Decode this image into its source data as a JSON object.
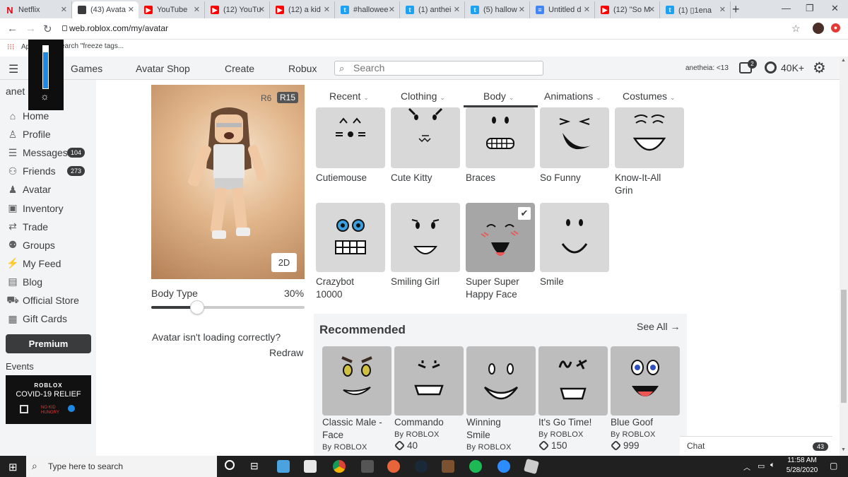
{
  "browser": {
    "tabs": [
      {
        "title": "Netflix",
        "icon": "netflix-icon",
        "color": "#e50914",
        "glyph": "N"
      },
      {
        "title": "(43) Avata",
        "icon": "roblox-icon",
        "color": "#393b3d",
        "glyph": ""
      },
      {
        "title": "YouTube",
        "icon": "youtube-icon",
        "color": "#ff0000",
        "glyph": "▶"
      },
      {
        "title": "(12) YouTu",
        "icon": "youtube-icon",
        "color": "#ff0000",
        "glyph": "▶"
      },
      {
        "title": "(12) a kid",
        "icon": "youtube-icon",
        "color": "#ff0000",
        "glyph": "▶"
      },
      {
        "title": "#hallowee",
        "icon": "twitter-icon",
        "color": "#1da1f2",
        "glyph": "t"
      },
      {
        "title": "(1) anthei",
        "icon": "twitter-icon",
        "color": "#1da1f2",
        "glyph": "t"
      },
      {
        "title": "(5) hallow",
        "icon": "twitter-icon",
        "color": "#1da1f2",
        "glyph": "t"
      },
      {
        "title": "Untitled d",
        "icon": "docs-icon",
        "color": "#4285f4",
        "glyph": "≡"
      },
      {
        "title": "(12) \"So M",
        "icon": "youtube-icon",
        "color": "#ff0000",
        "glyph": "▶"
      },
      {
        "title": "(1) ▯1ena",
        "icon": "twitter-icon",
        "color": "#1da1f2",
        "glyph": "t"
      }
    ],
    "url": "web.roblox.com/my/avatar",
    "bookmark_text": "Ap",
    "bookmark_search": "earch \"freeze tags..."
  },
  "header": {
    "links": [
      "Games",
      "Avatar Shop",
      "Create",
      "Robux"
    ],
    "search_placeholder": "Search",
    "username": "anetheia: <13",
    "messages_badge": "2",
    "robux": "40K+"
  },
  "sidebar": {
    "username": "anet",
    "items": [
      {
        "label": "Home",
        "icon": "home-icon",
        "glyph": "⌂",
        "badge": ""
      },
      {
        "label": "Profile",
        "icon": "profile-icon",
        "glyph": "♙",
        "badge": ""
      },
      {
        "label": "Messages",
        "icon": "messages-icon",
        "glyph": "☰",
        "badge": "104"
      },
      {
        "label": "Friends",
        "icon": "friends-icon",
        "glyph": "⚇",
        "badge": "273"
      },
      {
        "label": "Avatar",
        "icon": "avatar-icon",
        "glyph": "♟",
        "badge": ""
      },
      {
        "label": "Inventory",
        "icon": "inventory-icon",
        "glyph": "▣",
        "badge": ""
      },
      {
        "label": "Trade",
        "icon": "trade-icon",
        "glyph": "⇄",
        "badge": ""
      },
      {
        "label": "Groups",
        "icon": "groups-icon",
        "glyph": "⚉",
        "badge": ""
      },
      {
        "label": "My Feed",
        "icon": "feed-icon",
        "glyph": "⚡",
        "badge": ""
      },
      {
        "label": "Blog",
        "icon": "blog-icon",
        "glyph": "▤",
        "badge": ""
      },
      {
        "label": "Official Store",
        "icon": "store-icon",
        "glyph": "⛟",
        "badge": ""
      },
      {
        "label": "Gift Cards",
        "icon": "giftcard-icon",
        "glyph": "▦",
        "badge": ""
      }
    ],
    "premium": "Premium",
    "events": "Events",
    "event_banner": {
      "brand": "ROBLOX",
      "title": "COVID-19 RELIEF",
      "partner": "NO KID HUNGRY"
    }
  },
  "avatar": {
    "r6": "R6",
    "r15": "R15",
    "toggle_2d": "2D",
    "body_type_label": "Body Type",
    "body_type_value": "30%",
    "body_type_fraction": 0.3,
    "help_text": "Avatar isn't loading correctly?",
    "redraw": "Redraw"
  },
  "categories": [
    "Recent",
    "Clothing",
    "Body",
    "Animations",
    "Costumes"
  ],
  "active_category": "Body",
  "items": [
    {
      "name": "Cutiemouse",
      "face": "cutiemouse"
    },
    {
      "name": "Cute Kitty",
      "face": "kitty"
    },
    {
      "name": "Braces",
      "face": "braces"
    },
    {
      "name": "So Funny",
      "face": "sofunny"
    },
    {
      "name": "Know-It-All Grin",
      "face": "knowitall"
    },
    {
      "name": "Crazybot 10000",
      "face": "crazybot"
    },
    {
      "name": "Smiling Girl",
      "face": "smilinggirl"
    },
    {
      "name": "Super Super Happy Face",
      "face": "superhappy",
      "selected": true
    },
    {
      "name": "Smile",
      "face": "smile"
    }
  ],
  "recommended": {
    "title": "Recommended",
    "see_all": "See All",
    "items": [
      {
        "name": "Classic Male - Face",
        "by": "By  ROBLOX",
        "price": ""
      },
      {
        "name": "Commando",
        "by": "By  ROBLOX",
        "price": "40"
      },
      {
        "name": "Winning Smile",
        "by": "By  ROBLOX",
        "price": ""
      },
      {
        "name": "It's Go Time!",
        "by": "By  ROBLOX",
        "price": "150"
      },
      {
        "name": "Blue Goof",
        "by": "By  ROBLOX",
        "price": "999"
      }
    ]
  },
  "chat": {
    "label": "Chat",
    "count": "43"
  },
  "taskbar": {
    "search_placeholder": "Type here to search",
    "time": "11:58 AM",
    "date": "5/28/2020"
  },
  "brightness_level": 0.85
}
